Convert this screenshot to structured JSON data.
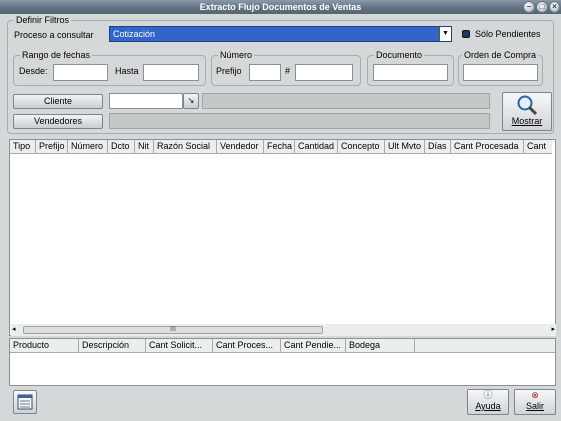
{
  "window": {
    "title": "Extracto Flujo Documentos de Ventas"
  },
  "filters": {
    "legend": "Definir Filtros",
    "process_label": "Proceso a consultar",
    "process_value": "Cotización",
    "only_pending_label": "Sólo Pendientes",
    "only_pending_checked": true,
    "date_range": {
      "legend": "Rango de fechas",
      "from_label": "Desde:",
      "to_label": "Hasta"
    },
    "number": {
      "legend": "Número",
      "prefix_label": "Prefijo",
      "hash_label": "#"
    },
    "document": {
      "legend": "Documento"
    },
    "purchase_order": {
      "legend": "Orden de Compra"
    },
    "client_button": "Cliente",
    "sellers_button": "Vendedores",
    "show_button": "Mostrar"
  },
  "main_table": {
    "columns": [
      "Tipo",
      "Prefijo",
      "Número",
      "Dcto",
      "Nit",
      "Razón Social",
      "Vendedor",
      "Fecha",
      "Cantidad",
      "Concepto",
      "Ult Mvto",
      "Días",
      "Cant Procesada",
      "Cant"
    ]
  },
  "detail_table": {
    "columns": [
      "Producto",
      "Descripción",
      "Cant Solicit...",
      "Cant Proces...",
      "Cant Pendie...",
      "Bodega"
    ]
  },
  "footer": {
    "help_button": "Ayuda",
    "exit_button": "Salir"
  },
  "colors": {
    "accent": "#3265c8",
    "titlebar": "#5f7080",
    "background": "#d4d8d8"
  }
}
